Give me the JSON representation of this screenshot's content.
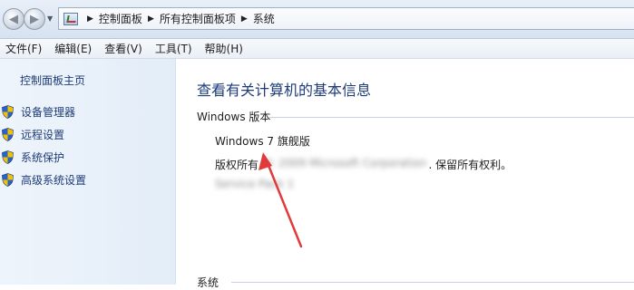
{
  "address_bar": {
    "breadcrumbs": [
      "控制面板",
      "所有控制面板项",
      "系统"
    ],
    "back_icon": "back-arrow-icon",
    "forward_icon": "forward-arrow-icon"
  },
  "menu": {
    "items": [
      "文件(F)",
      "编辑(E)",
      "查看(V)",
      "工具(T)",
      "帮助(H)"
    ]
  },
  "sidebar": {
    "home_label": "控制面板主页",
    "links": [
      {
        "label": "设备管理器",
        "icon": "shield-icon"
      },
      {
        "label": "远程设置",
        "icon": "shield-icon"
      },
      {
        "label": "系统保护",
        "icon": "shield-icon"
      },
      {
        "label": "高级系统设置",
        "icon": "shield-icon"
      }
    ]
  },
  "main": {
    "heading": "查看有关计算机的基本信息",
    "windows_edition_section": "Windows 版本",
    "edition_name": "Windows 7 旗舰版",
    "copyright_prefix": "版权所有",
    "copyright_suffix": ". 保留所有权利。",
    "system_section": "系统"
  },
  "annotation": {
    "arrow_color": "#e03a3a"
  }
}
